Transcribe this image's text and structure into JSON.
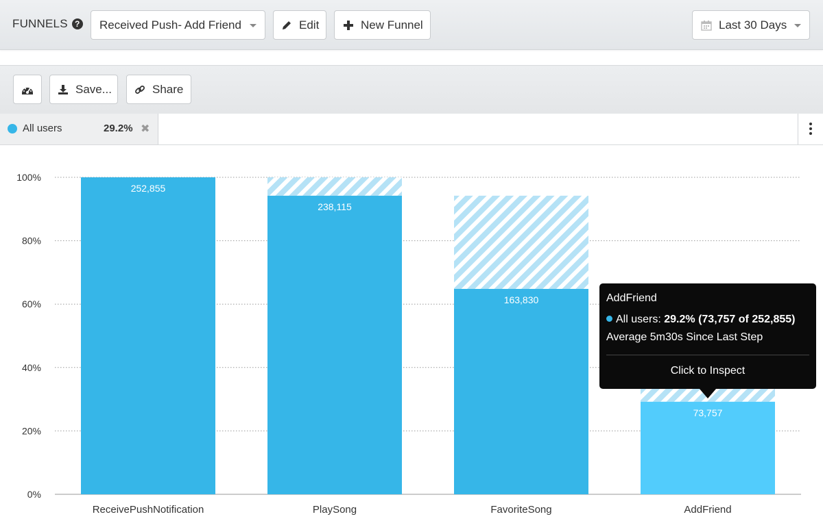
{
  "header": {
    "title": "FUNNELS",
    "funnel_select": "Received Push- Add Friend",
    "edit_label": "Edit",
    "new_funnel_label": "New Funnel",
    "date_range": "Last 30 Days"
  },
  "toolbar": {
    "save_label": "Save...",
    "share_label": "Share"
  },
  "segment": {
    "name": "All users",
    "conversion": "29.2%",
    "color": "#36b6e8"
  },
  "tooltip": {
    "title": "AddFriend",
    "series_label": "All users:",
    "series_value": "29.2% (73,757 of 252,855)",
    "avg_text": "Average 5m30s Since Last Step",
    "action": "Click to Inspect"
  },
  "chart_data": {
    "type": "bar",
    "categories": [
      "ReceivePushNotification",
      "PlaySong",
      "FavoriteSong",
      "AddFriend"
    ],
    "values": [
      100,
      94.2,
      64.8,
      29.2
    ],
    "previous_step_values": [
      100,
      100,
      94.2,
      64.8
    ],
    "labels": [
      "252,855",
      "238,115",
      "163,830",
      "73,757"
    ],
    "ylim": [
      0,
      100
    ],
    "yticks": [
      "0%",
      "20%",
      "40%",
      "60%",
      "80%",
      "100%"
    ],
    "highlight_index": 3,
    "bar_color": "#36b6e8",
    "highlight_color": "#52ccfc",
    "hatch_color": "#b5e2f6",
    "grid": true
  }
}
